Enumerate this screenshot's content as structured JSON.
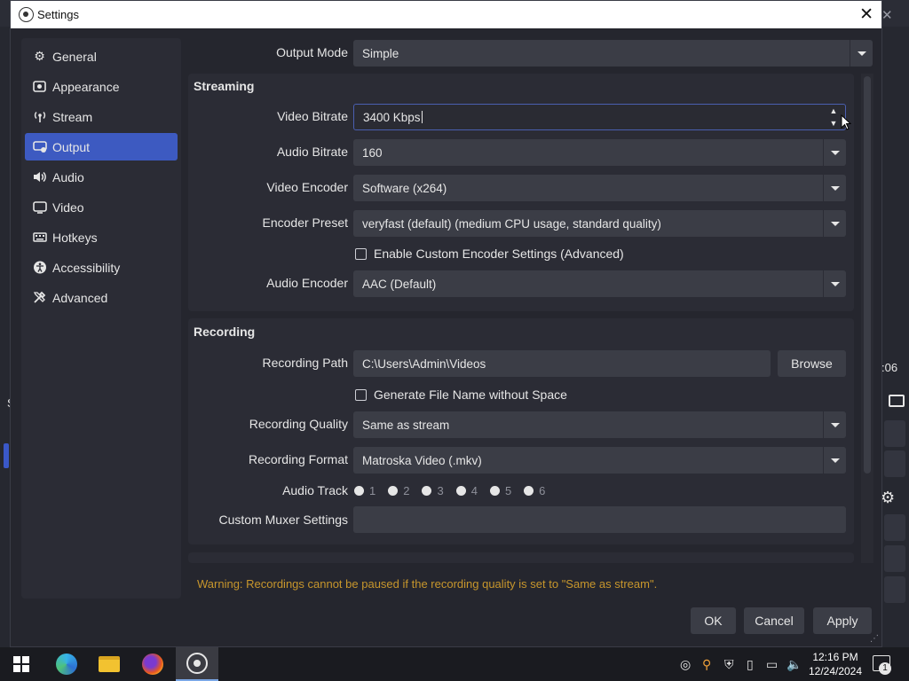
{
  "window": {
    "title": "Settings"
  },
  "sidebar": {
    "items": [
      {
        "label": "General",
        "icon": "gear-icon",
        "active": false
      },
      {
        "label": "Appearance",
        "icon": "appearance-icon",
        "active": false
      },
      {
        "label": "Stream",
        "icon": "antenna-icon",
        "active": false
      },
      {
        "label": "Output",
        "icon": "monitor-output-icon",
        "active": true
      },
      {
        "label": "Audio",
        "icon": "speaker-icon",
        "active": false
      },
      {
        "label": "Video",
        "icon": "display-icon",
        "active": false
      },
      {
        "label": "Hotkeys",
        "icon": "keyboard-icon",
        "active": false
      },
      {
        "label": "Accessibility",
        "icon": "accessibility-icon",
        "active": false
      },
      {
        "label": "Advanced",
        "icon": "tools-icon",
        "active": false
      }
    ]
  },
  "output_mode": {
    "label": "Output Mode",
    "value": "Simple"
  },
  "streaming": {
    "title": "Streaming",
    "video_bitrate": {
      "label": "Video Bitrate",
      "value": "3400 Kbps"
    },
    "audio_bitrate": {
      "label": "Audio Bitrate",
      "value": "160"
    },
    "video_encoder": {
      "label": "Video Encoder",
      "value": "Software (x264)"
    },
    "encoder_preset": {
      "label": "Encoder Preset",
      "value": "veryfast (default) (medium CPU usage, standard quality)"
    },
    "custom_encoder": {
      "label": "Enable Custom Encoder Settings (Advanced)"
    },
    "audio_encoder": {
      "label": "Audio Encoder",
      "value": "AAC (Default)"
    }
  },
  "recording": {
    "title": "Recording",
    "path": {
      "label": "Recording Path",
      "value": "C:\\Users\\Admin\\Videos",
      "browse": "Browse"
    },
    "no_space": {
      "label": "Generate File Name without Space"
    },
    "quality": {
      "label": "Recording Quality",
      "value": "Same as stream"
    },
    "format": {
      "label": "Recording Format",
      "value": "Matroska Video (.mkv)"
    },
    "audio_track": {
      "label": "Audio Track",
      "tracks": [
        "1",
        "2",
        "3",
        "4",
        "5",
        "6"
      ]
    },
    "muxer": {
      "label": "Custom Muxer Settings",
      "value": ""
    }
  },
  "warning": "Warning: Recordings cannot be paused if the recording quality is set to \"Same as stream\".",
  "buttons": {
    "ok": "OK",
    "cancel": "Cancel",
    "apply": "Apply"
  },
  "background": {
    "time_fragment": ":06",
    "side_letter": "S"
  },
  "taskbar": {
    "time": "12:16 PM",
    "date": "12/24/2024",
    "notifications": "1"
  },
  "colors": {
    "accent": "#3d5ac1",
    "warning": "#c7962c"
  }
}
